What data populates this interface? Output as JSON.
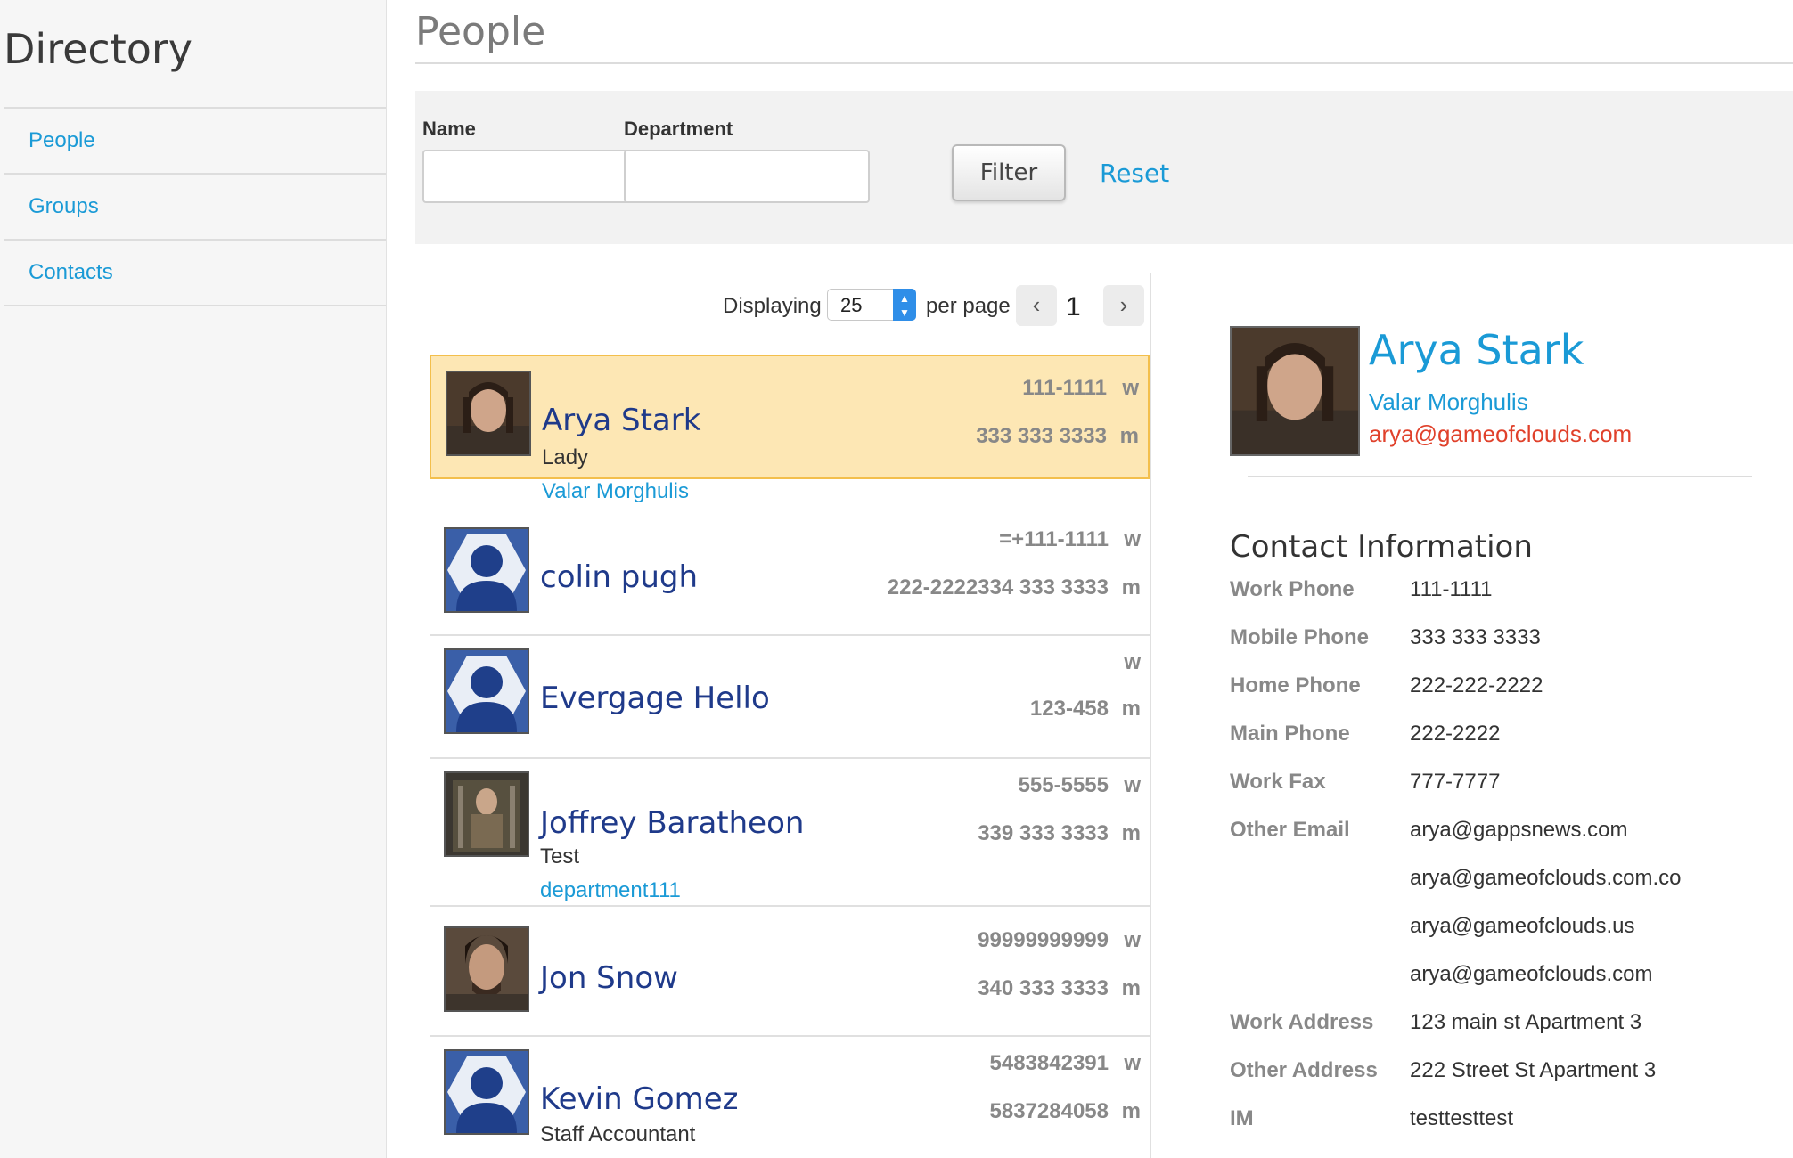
{
  "sidebar": {
    "title": "Directory",
    "items": [
      {
        "label": "People"
      },
      {
        "label": "Groups"
      },
      {
        "label": "Contacts"
      }
    ]
  },
  "main": {
    "title": "People"
  },
  "filter": {
    "name_label": "Name",
    "name_value": "",
    "department_label": "Department",
    "department_value": "",
    "filter_button": "Filter",
    "reset_link": "Reset"
  },
  "pager": {
    "displaying_label": "Displaying",
    "per_page_value": "25",
    "per_page_label": "per page",
    "prev_icon": "chevron-left-icon",
    "page_number": "1",
    "next_icon": "chevron-right-icon"
  },
  "people": [
    {
      "name": "Arya Stark",
      "title": "Lady",
      "department": "Valar Morghulis",
      "work": "111-1111",
      "work_type": "w",
      "mobile": "333 333 3333",
      "mobile_type": "m",
      "avatar": "photo",
      "selected": true
    },
    {
      "name": "colin pugh",
      "title": "",
      "department": "",
      "work": "=+111-1111",
      "work_type": "w",
      "mobile": "222-2222334 333 3333",
      "mobile_type": "m",
      "avatar": "default-user-icon"
    },
    {
      "name": "Evergage Hello",
      "title": "",
      "department": "",
      "work": "",
      "work_type": "w",
      "mobile": "123-458",
      "mobile_type": "m",
      "avatar": "default-user-icon"
    },
    {
      "name": "Joffrey Baratheon",
      "title": "Test",
      "department": "department111",
      "work": "555-5555",
      "work_type": "w",
      "mobile": "339 333 3333",
      "mobile_type": "m",
      "avatar": "photo"
    },
    {
      "name": "Jon Snow",
      "title": "",
      "department": "",
      "work": "99999999999",
      "work_type": "w",
      "mobile": "340 333 3333",
      "mobile_type": "m",
      "avatar": "photo"
    },
    {
      "name": "Kevin Gomez",
      "title": "Staff Accountant",
      "department": "",
      "work": "5483842391",
      "work_type": "w",
      "mobile": "5837284058",
      "mobile_type": "m",
      "avatar": "default-user-icon"
    }
  ],
  "detail": {
    "name": "Arya Stark",
    "department": "Valar Morghulis",
    "email": "arya@gameofclouds.com",
    "contact_heading": "Contact Information",
    "contact_info": [
      {
        "label": "Work Phone",
        "value": "111-1111"
      },
      {
        "label": "Mobile Phone",
        "value": "333 333 3333"
      },
      {
        "label": "Home Phone",
        "value": "222-222-2222"
      },
      {
        "label": "Main Phone",
        "value": "222-2222"
      },
      {
        "label": "Work Fax",
        "value": "777-7777"
      },
      {
        "label": "Other Email",
        "value": "arya@gappsnews.com"
      },
      {
        "label": "",
        "value": "arya@gameofclouds.com.co"
      },
      {
        "label": "",
        "value": "arya@gameofclouds.us"
      },
      {
        "label": "",
        "value": "arya@gameofclouds.com"
      },
      {
        "label": "Work Address",
        "value": "123 main st Apartment 3"
      },
      {
        "label": "Other Address",
        "value": "222 Street St Apartment 3"
      },
      {
        "label": "IM",
        "value": "testtesttest"
      }
    ]
  },
  "colors": {
    "link": "#1a9ad6",
    "name": "#1f3a8a",
    "selected_bg": "#fde7b4",
    "selected_border": "#f3bf4c",
    "email": "#e0412b"
  }
}
